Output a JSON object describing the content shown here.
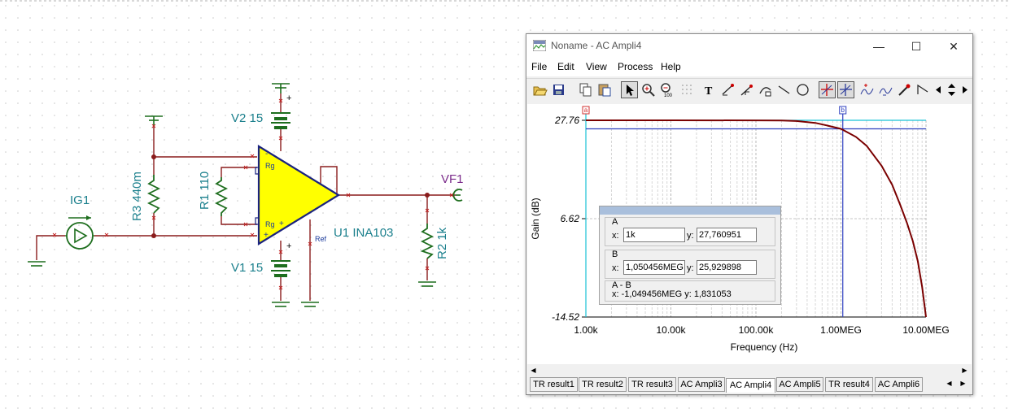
{
  "schematic": {
    "components": {
      "ig1": "IG1",
      "r3": "R3 440m",
      "r1": "R1 110",
      "v2": "V2 15",
      "v1": "V1 15",
      "u1": "U1 INA103",
      "vf1": "VF1",
      "r2": "R2 1k"
    },
    "pins": {
      "rg_top": "Rg",
      "rg_bottom": "Rg",
      "ref": "Ref",
      "minus": "-",
      "plus": "+",
      "plus2": "+",
      "v2_plus": "+",
      "v1_plus": "+"
    }
  },
  "window": {
    "title": "Noname - AC Ampli4",
    "controls": {
      "minimize": "—",
      "maximize": "☐",
      "close": "✕"
    },
    "menu": [
      "File",
      "Edit",
      "View",
      "Process",
      "Help"
    ],
    "toolbar_icons": [
      "open-icon",
      "save-icon",
      "copy-icon",
      "paste-icon",
      "pointer-icon",
      "zoom-in-icon",
      "zoom-100-icon",
      "grid-icon",
      "text-icon",
      "line-tool-icon",
      "slope-tool-icon",
      "curve-tool-icon",
      "line-icon",
      "circle-icon",
      "cursor-a-icon",
      "cursor-b-icon",
      "peak-icon",
      "valley-icon",
      "marker-icon",
      "ramp-icon",
      "prev-icon",
      "updown-icon",
      "next-icon"
    ],
    "tabs": [
      "TR result1",
      "TR result2",
      "TR result3",
      "AC Ampli3",
      "AC Ampli4",
      "AC Ampli5",
      "TR result4",
      "AC Ampli6"
    ],
    "selected_tab": "AC Ampli4"
  },
  "cursor_panel": {
    "a": {
      "label": "A",
      "x_label": "x:",
      "x": "1k",
      "y_label": "y:",
      "y": "27,760951"
    },
    "b": {
      "label": "B",
      "x_label": "x:",
      "x": "1,050456MEG",
      "y_label": "y:",
      "y": "25,929898"
    },
    "diff": {
      "label": "A - B",
      "text": "x:  -1,049456MEG y: 1,831053"
    }
  },
  "chart_data": {
    "type": "line",
    "xlabel": "Frequency (Hz)",
    "ylabel": "Gain (dB)",
    "x_scale": "log",
    "xlim": [
      1000,
      10000000
    ],
    "ylim": [
      -14.52,
      27.76
    ],
    "x_ticks": [
      1000,
      10000,
      100000,
      1000000,
      10000000
    ],
    "x_tick_labels": [
      "1.00k",
      "10.00k",
      "100.00k",
      "1.00MEG",
      "10.00MEG"
    ],
    "y_ticks": [
      27.76,
      6.62,
      -14.52
    ],
    "y_tick_labels": [
      "27.76",
      "6.62",
      "-14.52"
    ],
    "grid": true,
    "series": [
      {
        "color": "#7a0000",
        "x": [
          1000,
          10000,
          100000,
          200000,
          300000,
          500000,
          700000,
          1000000,
          1500000,
          2000000,
          3000000,
          4000000,
          5000000,
          6000000,
          7000000,
          8000000,
          9000000,
          10000000
        ],
        "y": [
          27.76,
          27.76,
          27.75,
          27.72,
          27.6,
          27.2,
          26.6,
          25.93,
          24.2,
          22.3,
          18.0,
          13.9,
          9.5,
          5.6,
          1.8,
          -2.5,
          -8.0,
          -14.52
        ]
      }
    ],
    "cursors": [
      {
        "label": "a",
        "x": 1000,
        "y": 27.760951,
        "color": "#19c2d6"
      },
      {
        "label": "b",
        "x": 1050456,
        "y": 25.929898,
        "color": "#2d3fbf"
      }
    ]
  },
  "colors": {
    "schematic_wire": "#8a1c1c",
    "component": "#1e6e1e",
    "label": "#1a7f8c",
    "opamp_fill": "#ffff00",
    "opamp_edge": "#1a237e",
    "vf_label": "#7a2a8a",
    "curve": "#7a0000"
  }
}
